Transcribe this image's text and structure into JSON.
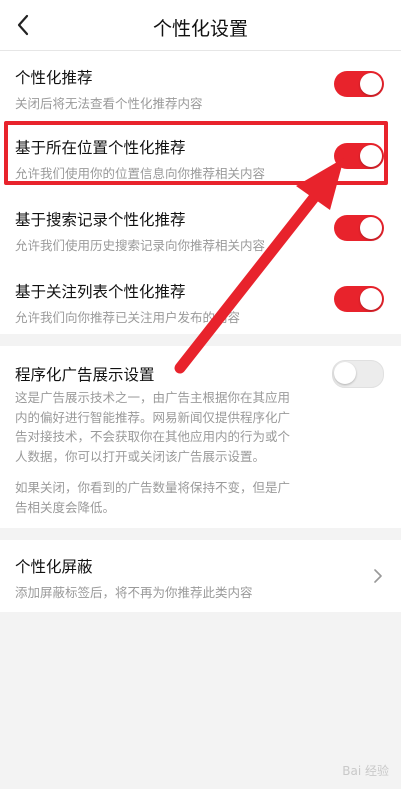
{
  "header": {
    "title": "个性化设置",
    "back_icon": "chevron-left-icon"
  },
  "rows": [
    {
      "title": "个性化推荐",
      "subtitle": "关闭后将无法查看个性化推荐内容",
      "enabled": true
    },
    {
      "title": "基于所在位置个性化推荐",
      "subtitle": "允许我们使用你的位置信息向你推荐相关内容",
      "enabled": true
    },
    {
      "title": "基于搜索记录个性化推荐",
      "subtitle": "允许我们使用历史搜索记录向你推荐相关内容",
      "enabled": true
    },
    {
      "title": "基于关注列表个性化推荐",
      "subtitle": "允许我们向你推荐已关注用户发布的内容",
      "enabled": true
    }
  ],
  "ads": {
    "title": "程序化广告展示设置",
    "enabled": false,
    "desc_lines": [
      "这是广告展示技术之一，由广告主根据你在其应用",
      "内的偏好进行智能推荐。网易新闻仅提供程序化广",
      "告对接技术，不会获取你在其他应用内的行为或个",
      "人数据，你可以打开或关闭该广告展示设置。"
    ],
    "note_lines": [
      "如果关闭，你看到的广告数量将保持不变，但是广",
      "告相关度会降低。"
    ]
  },
  "block": {
    "title": "个性化屏蔽",
    "subtitle": "添加屏蔽标签后，将不再为你推荐此类内容"
  },
  "watermark": "Bai 经验",
  "colors": {
    "accent": "#e8232c",
    "toggle_off": "#ececec",
    "bg": "#f3f3f3"
  }
}
